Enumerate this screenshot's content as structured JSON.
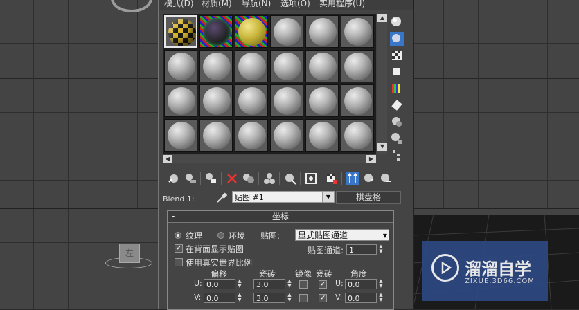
{
  "menubar": {
    "items": [
      "模式(D)",
      "材质(M)",
      "导航(N)",
      "选项(O)",
      "实用程序(U)"
    ]
  },
  "material_slots": {
    "rows": 4,
    "cols": 6,
    "active_slot": 1
  },
  "name_row": {
    "label": "Blend 1:",
    "map_name": "贴图 #1",
    "map_type": "棋盘格"
  },
  "rollout": {
    "title": "坐标",
    "collapse_symbol": "-",
    "radio_texture": "纹理",
    "radio_environment": "环境",
    "mapping_label": "贴图:",
    "mapping_value": "显式贴图通道",
    "show_back": "在背面显示贴图",
    "real_world": "使用真实世界比例",
    "map_channel_label": "贴图通道:",
    "map_channel_value": "1",
    "col_offset": "偏移",
    "col_tiling": "瓷砖",
    "col_mirror": "镜像",
    "col_tile": "瓷砖",
    "col_angle": "角度",
    "u_label": "U:",
    "v_label": "V:",
    "u_angle_label": "U:",
    "v_angle_label": "V:",
    "u_offset": "0.0",
    "u_tiling": "3.0",
    "v_offset": "0.0",
    "v_tiling": "3.0",
    "u_angle": "0.0",
    "v_angle": "0.0"
  },
  "viewport": {
    "left_cube_label": "左"
  },
  "logo": {
    "title": "溜溜自学",
    "subtitle": "ZIXUE.3D66.COM"
  }
}
